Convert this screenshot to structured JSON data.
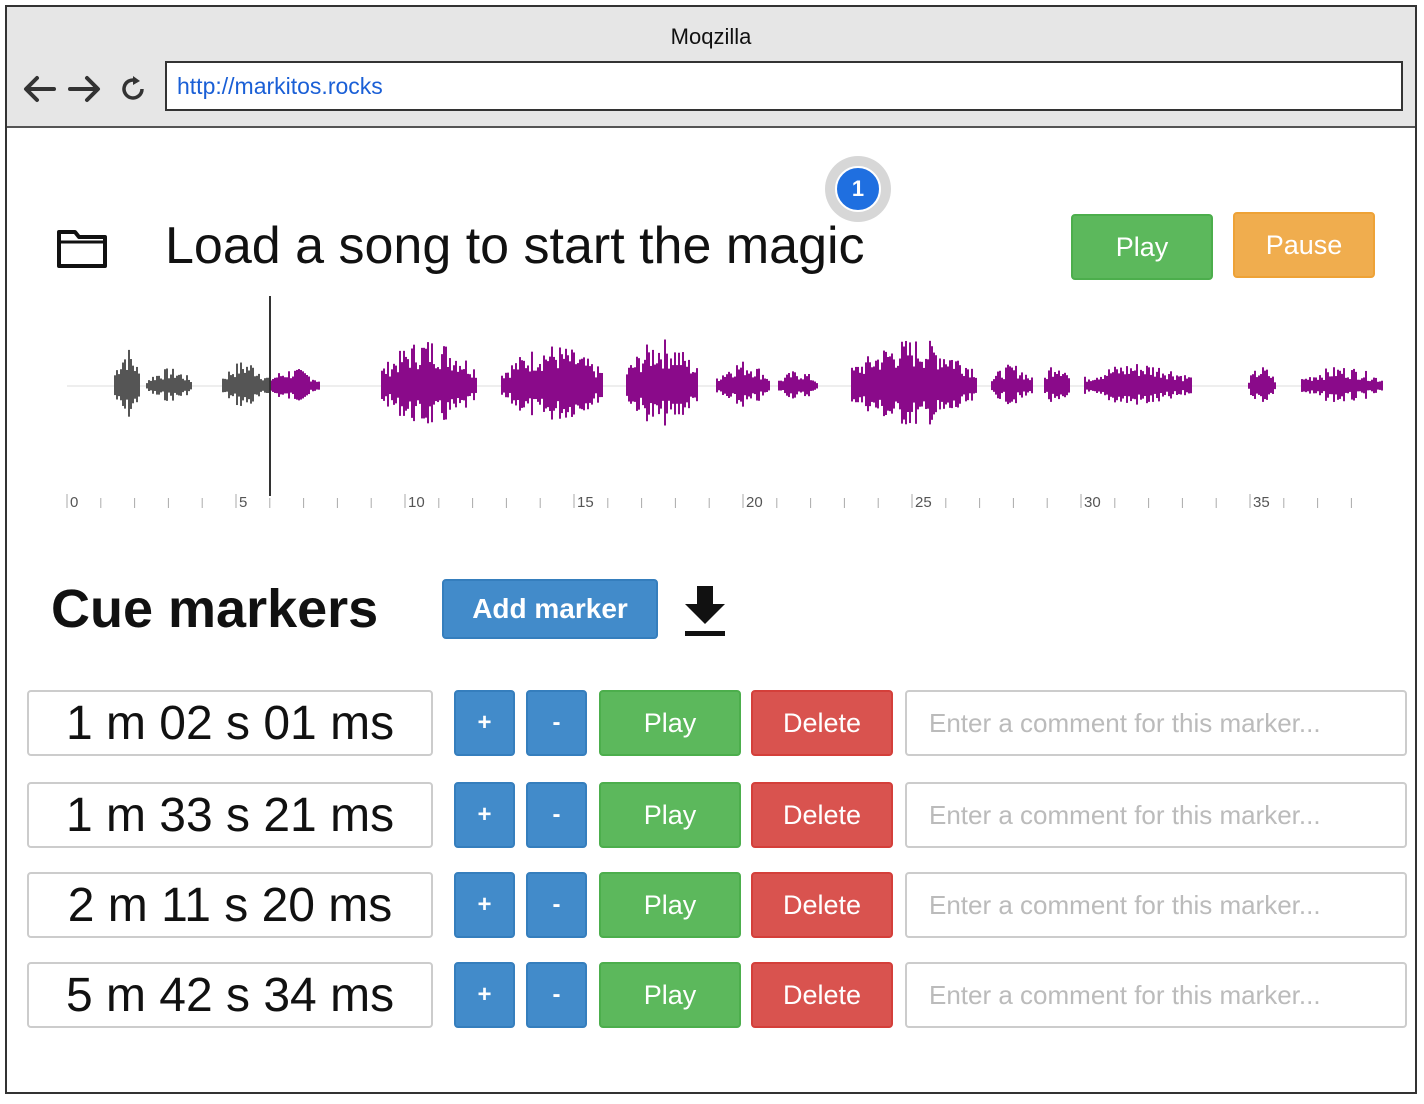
{
  "window": {
    "title": "Moqzilla",
    "url": "http://markitos.rocks"
  },
  "player": {
    "badge": "1",
    "load_title": "Load a song to start the magic",
    "play_label": "Play",
    "pause_label": "Pause"
  },
  "timeline": {
    "ticks": [
      "0",
      "5",
      "10",
      "15",
      "20",
      "25",
      "30",
      "35"
    ]
  },
  "cue": {
    "title": "Cue markers",
    "add_marker_label": "Add marker",
    "markers": [
      {
        "time": "1 m 02 s 01 ms",
        "plus": "+",
        "minus": "-",
        "play": "Play",
        "delete": "Delete",
        "placeholder": "Enter a comment for this marker..."
      },
      {
        "time": "1 m 33 s 21 ms",
        "plus": "+",
        "minus": "-",
        "play": "Play",
        "delete": "Delete",
        "placeholder": "Enter a comment for this marker..."
      },
      {
        "time": "2 m 11 s 20 ms",
        "plus": "+",
        "minus": "-",
        "play": "Play",
        "delete": "Delete",
        "placeholder": "Enter a comment for this marker..."
      },
      {
        "time": "5 m 42 s 34 ms",
        "plus": "+",
        "minus": "-",
        "play": "Play",
        "delete": "Delete",
        "placeholder": "Enter a comment for this marker..."
      }
    ]
  },
  "colors": {
    "played": "#555555",
    "unplayed": "#8a0a8a",
    "play_green": "#5cb85c",
    "pause_orange": "#f0ad4e",
    "primary_blue": "#428bca",
    "danger_red": "#d9534f"
  }
}
